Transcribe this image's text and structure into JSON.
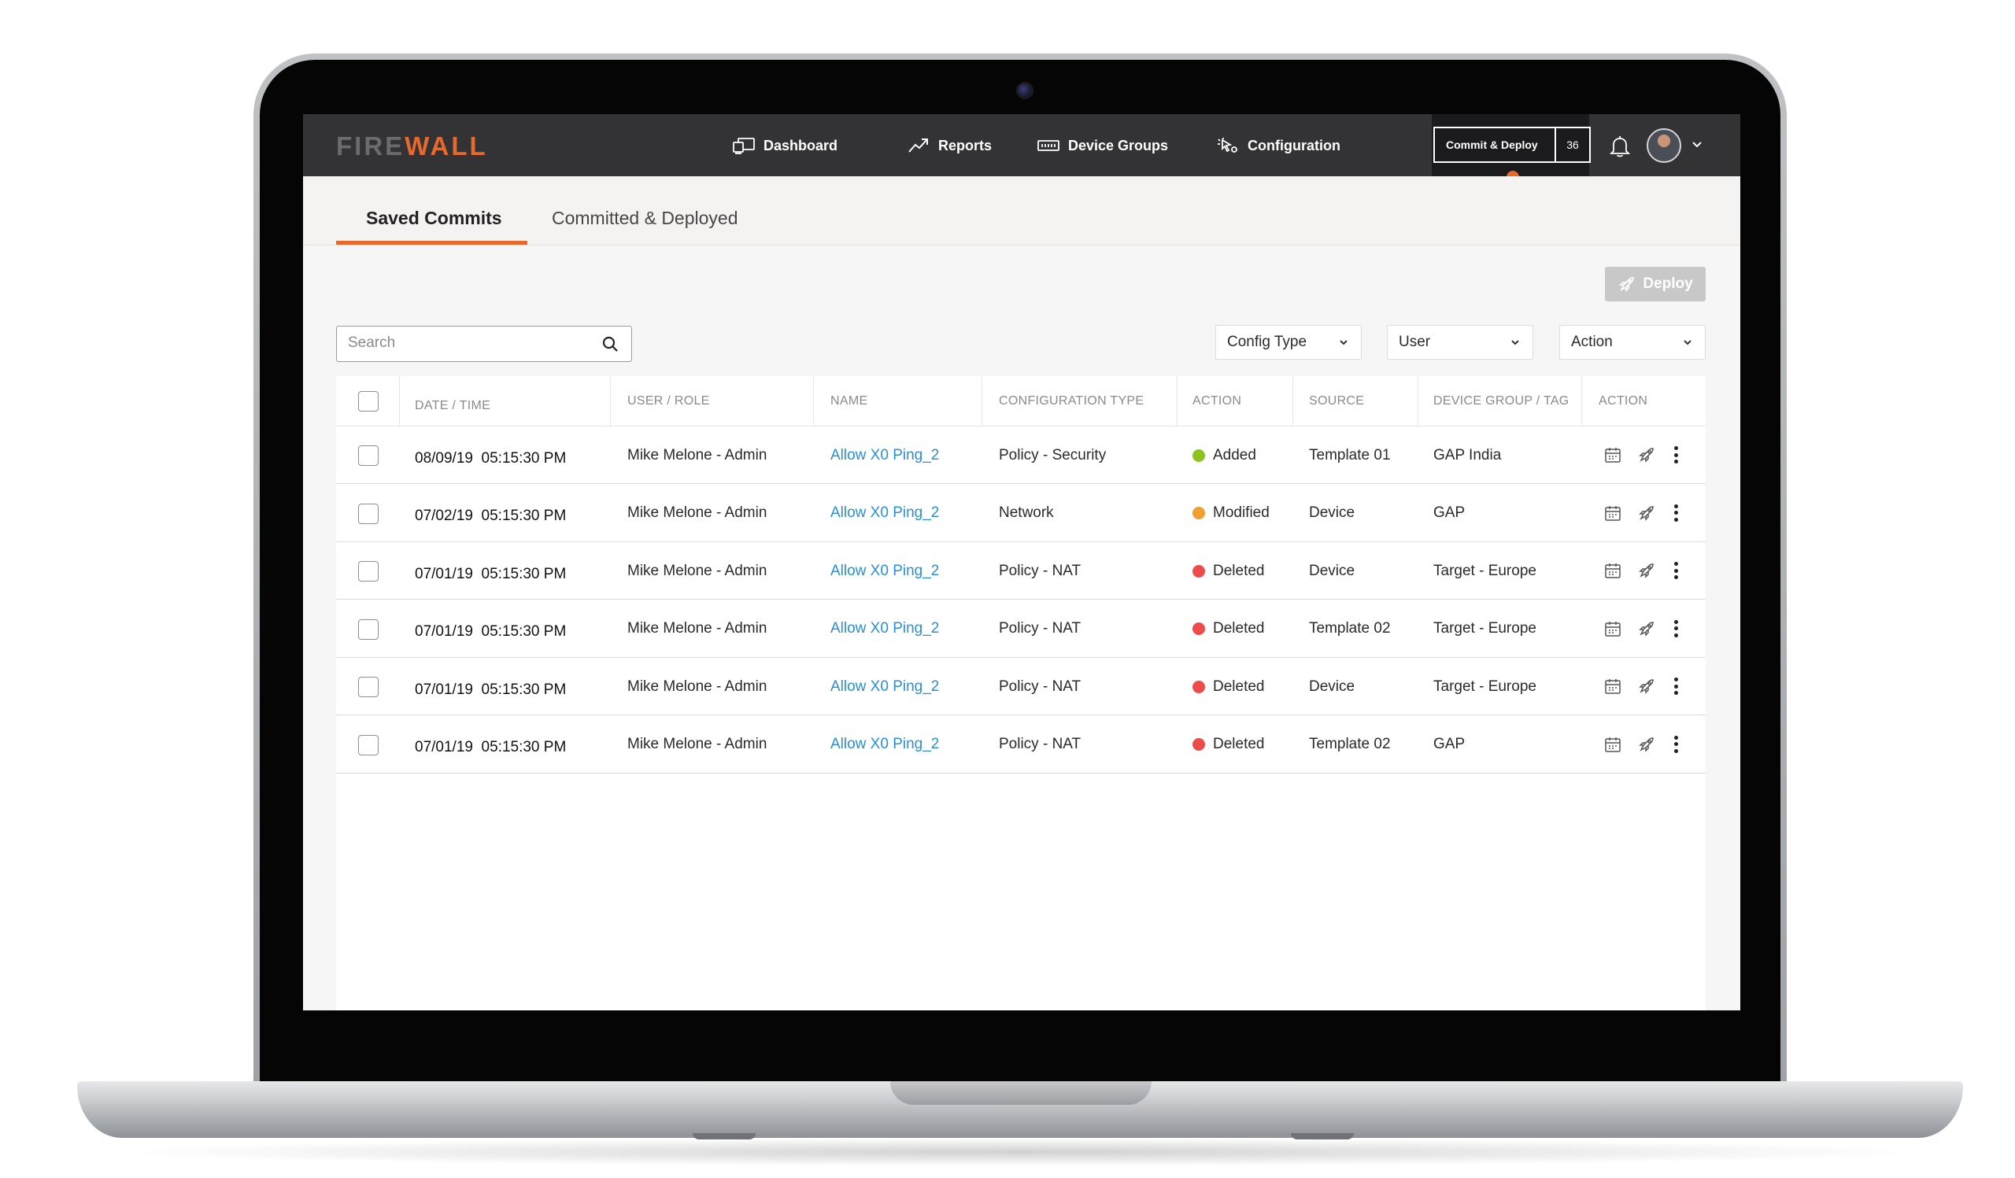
{
  "app": {
    "logo_part1": "FIRE",
    "logo_part2": "WALL",
    "accent_color": "#e8692c"
  },
  "nav": {
    "items": [
      {
        "label": "Dashboard",
        "icon": "dashboard-icon"
      },
      {
        "label": "Reports",
        "icon": "trend-icon"
      },
      {
        "label": "Device Groups",
        "icon": "device-groups-icon"
      },
      {
        "label": "Configuration",
        "icon": "configuration-icon"
      }
    ],
    "commit_label": "Commit & Deploy",
    "commit_count": "36"
  },
  "tabs": [
    {
      "label": "Saved Commits",
      "active": true
    },
    {
      "label": "Committed & Deployed",
      "active": false
    }
  ],
  "toolbar": {
    "deploy_label": "Deploy",
    "search_placeholder": "Search",
    "filters": [
      "Config Type",
      "User",
      "Action"
    ]
  },
  "table": {
    "headers": [
      "DATE / TIME",
      "USER / ROLE",
      "NAME",
      "CONFIGURATION TYPE",
      "ACTION",
      "SOURCE",
      "DEVICE GROUP / TAG",
      "ACTION"
    ],
    "rows": [
      {
        "date": "08/09/19",
        "time": "05:15:30 PM",
        "user": "Mike Melone - Admin",
        "name": "Allow X0 Ping_2",
        "config_type": "Policy - Security",
        "action": "Added",
        "action_color": "#8dc21f",
        "source": "Template 01",
        "device_group": "GAP India"
      },
      {
        "date": "07/02/19",
        "time": "05:15:30 PM",
        "user": "Mike Melone - Admin",
        "name": "Allow X0 Ping_2",
        "config_type": "Network",
        "action": "Modified",
        "action_color": "#f0a030",
        "source": "Device",
        "device_group": "GAP"
      },
      {
        "date": "07/01/19",
        "time": "05:15:30 PM",
        "user": "Mike Melone - Admin",
        "name": "Allow X0 Ping_2",
        "config_type": "Policy - NAT",
        "action": "Deleted",
        "action_color": "#ee4b4b",
        "source": "Device",
        "device_group": "Target - Europe"
      },
      {
        "date": "07/01/19",
        "time": "05:15:30 PM",
        "user": "Mike Melone - Admin",
        "name": "Allow X0 Ping_2",
        "config_type": "Policy - NAT",
        "action": "Deleted",
        "action_color": "#ee4b4b",
        "source": "Template 02",
        "device_group": "Target - Europe"
      },
      {
        "date": "07/01/19",
        "time": "05:15:30 PM",
        "user": "Mike Melone - Admin",
        "name": "Allow X0 Ping_2",
        "config_type": "Policy - NAT",
        "action": "Deleted",
        "action_color": "#ee4b4b",
        "source": "Device",
        "device_group": "Target - Europe"
      },
      {
        "date": "07/01/19",
        "time": "05:15:30 PM",
        "user": "Mike Melone - Admin",
        "name": "Allow X0 Ping_2",
        "config_type": "Policy - NAT",
        "action": "Deleted",
        "action_color": "#ee4b4b",
        "source": "Template 02",
        "device_group": "GAP"
      }
    ]
  }
}
